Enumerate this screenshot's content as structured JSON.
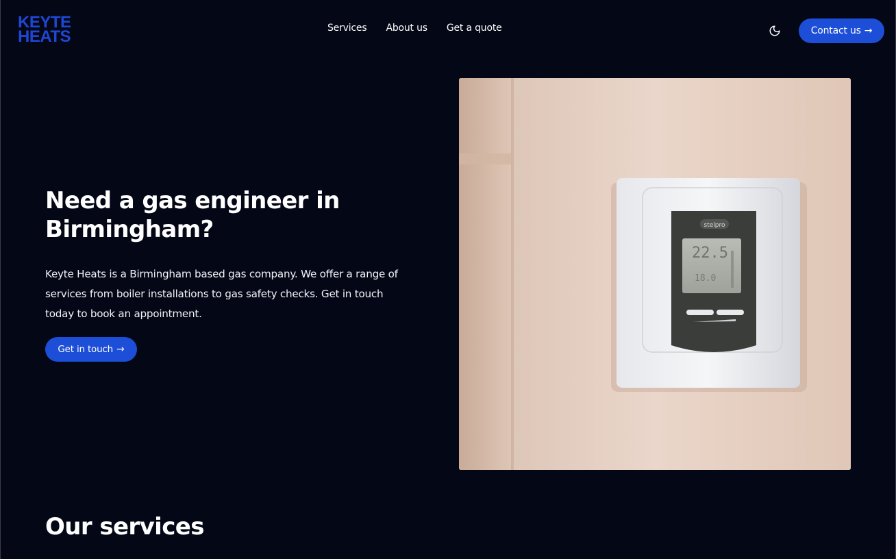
{
  "brand": {
    "logo_line1": "KEYTE",
    "logo_line2": "HEATS",
    "color": "#1e47d6"
  },
  "nav": {
    "items": [
      {
        "label": "Services"
      },
      {
        "label": "About us"
      },
      {
        "label": "Get a quote"
      }
    ]
  },
  "header": {
    "theme_toggle_icon": "moon-icon",
    "contact_label": "Contact us",
    "contact_arrow": "→"
  },
  "hero": {
    "title": "Need a gas engineer in Birmingham?",
    "description": "Keyte Heats is a Birmingham based gas company. We offer a range of services from boiler installations to gas safety checks. Get in touch today to book an appointment.",
    "cta_label": "Get in touch",
    "cta_arrow": "→",
    "image_icon": "thermostat-photo",
    "thermostat_brand": "stelpro",
    "thermostat_temp_main": "22.5",
    "thermostat_temp_secondary": "18.0"
  },
  "services": {
    "title": "Our services"
  },
  "colors": {
    "background": "#040716",
    "accent": "#1d4ed8",
    "text": "#ffffff"
  }
}
